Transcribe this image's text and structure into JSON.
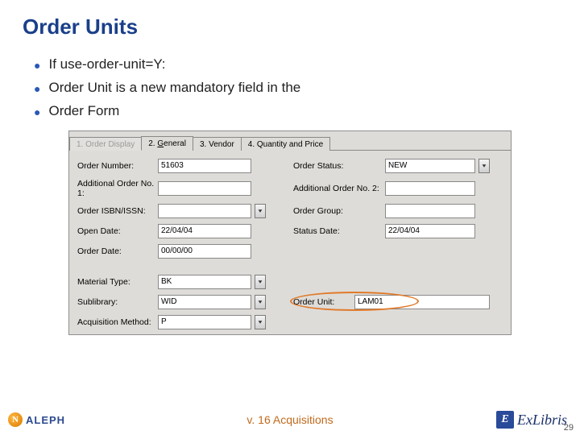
{
  "title": "Order Units",
  "bullets": [
    "If  use-order-unit=Y:",
    "Order Unit is a new mandatory field in the",
    "Order Form"
  ],
  "tabs": {
    "t1": "1. Order Display",
    "t2a": "2. ",
    "t2b": "G",
    "t2c": "eneral",
    "t3": "3. Vendor",
    "t4": "4. Quantity and Price"
  },
  "form": {
    "orderNumber_l": "Order Number:",
    "orderNumber_v": "51603",
    "orderStatus_l": "Order Status:",
    "orderStatus_v": "NEW",
    "addNo1_l": "Additional Order No. 1:",
    "addNo1_v": "",
    "addNo2_l": "Additional Order No. 2:",
    "addNo2_v": "",
    "isbn_l": "Order ISBN/ISSN:",
    "isbn_v": "",
    "orderGroup_l": "Order Group:",
    "orderGroup_v": "",
    "openDate_l": "Open Date:",
    "openDate_v": "22/04/04",
    "statusDate_l": "Status Date:",
    "statusDate_v": "22/04/04",
    "orderDate_l": "Order Date:",
    "orderDate_v": "00/00/00",
    "matType_l": "Material Type:",
    "matType_v": "BK",
    "sublib_l": "Sublibrary:",
    "sublib_v": "WID",
    "orderUnit_l": "Order Unit:",
    "orderUnit_v": "LAM01",
    "acqMethod_l": "Acquisition Method:",
    "acqMethod_v": "P"
  },
  "footer": {
    "aleph": "ALEPH",
    "center": "v. 16 Acquisitions",
    "exlibris": "ExLibris",
    "page": "29"
  }
}
